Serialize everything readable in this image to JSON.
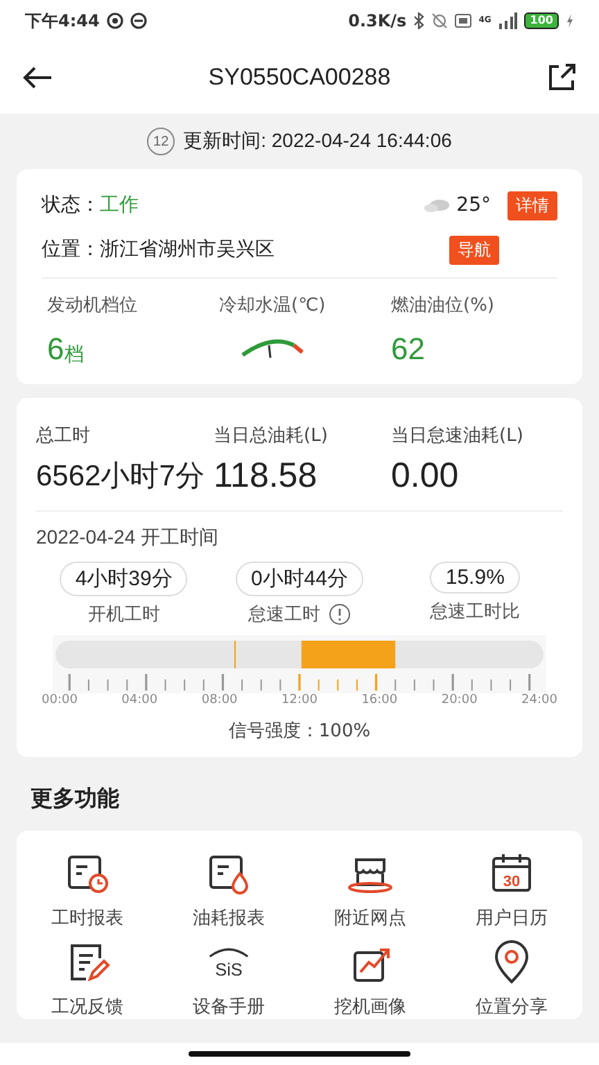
{
  "status_bar": {
    "time": "下午4:44",
    "speed": "0.3K/s",
    "network": "4G",
    "battery": "100"
  },
  "header": {
    "title": "SY0550CA00288"
  },
  "update": {
    "badge": "12",
    "text": "更新时间: 2022-04-24 16:44:06"
  },
  "status_card": {
    "status_label": "状态：",
    "status": "工作",
    "temperature": "25°",
    "detail_button": "详情",
    "location_label": "位置：",
    "location": "浙江省湖州市吴兴区",
    "nav_button": "导航",
    "metrics": [
      {
        "kind": "value",
        "label": "发动机档位",
        "value": "6",
        "unit": "档"
      },
      {
        "kind": "gauge",
        "label": "冷却水温(℃)"
      },
      {
        "kind": "value",
        "label": "燃油油位(%)",
        "value": "62"
      }
    ]
  },
  "work_card": {
    "stats": [
      {
        "label": "总工时",
        "value": "6562小时7分"
      },
      {
        "label": "当日总油耗(L)",
        "value": "118.58"
      },
      {
        "label": "当日怠速油耗(L)",
        "value": "0.00"
      }
    ],
    "date_title": "2022-04-24 开工时间",
    "pills": [
      {
        "value": "4小时39分",
        "label": "开机工时",
        "info": false
      },
      {
        "value": "0小时44分",
        "label": "怠速工时",
        "info": true
      },
      {
        "value": "15.9%",
        "label": "怠速工时比",
        "info": false
      }
    ],
    "axis_labels": [
      "00:00",
      "04:00",
      "08:00",
      "12:00",
      "16:00",
      "20:00",
      "24:00"
    ],
    "signal": "信号强度：100%"
  },
  "more": {
    "title": "更多功能",
    "items": [
      {
        "kind": "clock-report",
        "label": "工时报表"
      },
      {
        "kind": "drop-report",
        "label": "油耗报表"
      },
      {
        "kind": "shop",
        "label": "附近网点"
      },
      {
        "kind": "calendar",
        "label": "用户日历",
        "icon_text": "30"
      },
      {
        "kind": "pen-doc",
        "label": "工况反馈"
      },
      {
        "kind": "sis",
        "label": "设备手册",
        "icon_text": "SiS"
      },
      {
        "kind": "chart",
        "label": "挖机画像"
      },
      {
        "kind": "pin",
        "label": "位置分享"
      }
    ]
  }
}
